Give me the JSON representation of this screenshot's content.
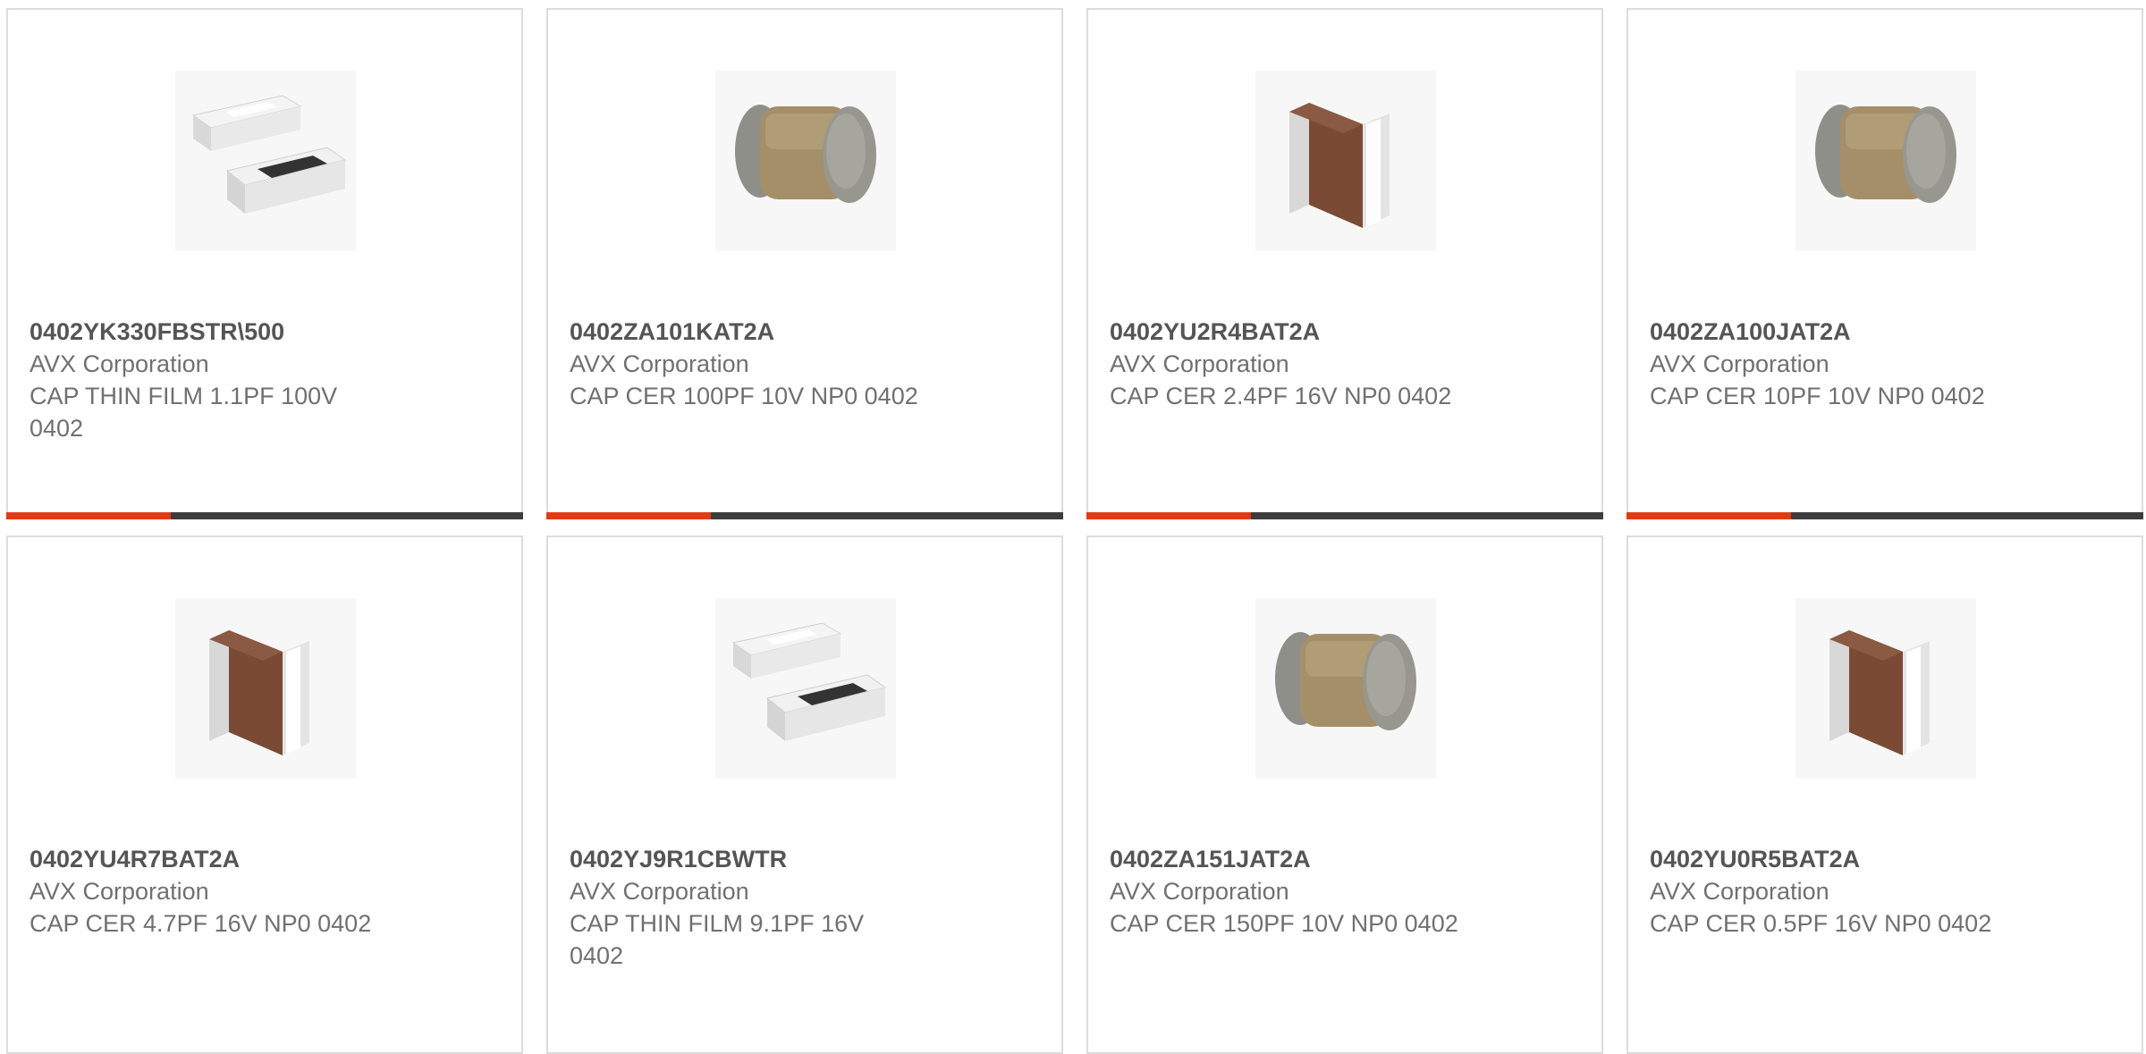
{
  "products": [
    {
      "part_number": "0402YK330FBSTR\\500",
      "manufacturer": "AVX Corporation",
      "description": "CAP THIN FILM 1.1PF 100V 0402",
      "image_icon": "thin-film-chip-icon"
    },
    {
      "part_number": "0402ZA101KAT2A",
      "manufacturer": "AVX Corporation",
      "description": "CAP CER 100PF 10V NP0 0402",
      "image_icon": "ceramic-chip-tan-icon"
    },
    {
      "part_number": "0402YU2R4BAT2A",
      "manufacturer": "AVX Corporation",
      "description": "CAP CER 2.4PF 16V NP0 0402",
      "image_icon": "ceramic-chip-brown-icon"
    },
    {
      "part_number": "0402ZA100JAT2A",
      "manufacturer": "AVX Corporation",
      "description": "CAP CER 10PF 10V NP0 0402",
      "image_icon": "ceramic-chip-tan-icon"
    },
    {
      "part_number": "0402YU4R7BAT2A",
      "manufacturer": "AVX Corporation",
      "description": "CAP CER 4.7PF 16V NP0 0402",
      "image_icon": "ceramic-chip-brown-icon"
    },
    {
      "part_number": "0402YJ9R1CBWTR",
      "manufacturer": "AVX Corporation",
      "description": "CAP THIN FILM 9.1PF 16V 0402",
      "image_icon": "thin-film-chip-icon"
    },
    {
      "part_number": "0402ZA151JAT2A",
      "manufacturer": "AVX Corporation",
      "description": "CAP CER 150PF 10V NP0 0402",
      "image_icon": "ceramic-chip-tan-icon"
    },
    {
      "part_number": "0402YU0R5BAT2A",
      "manufacturer": "AVX Corporation",
      "description": "CAP CER 0.5PF 16V NP0 0402",
      "image_icon": "ceramic-chip-brown-icon"
    }
  ],
  "colors": {
    "accent": "#e23a12",
    "bar": "#3d3d3d",
    "border": "#dcdcdc",
    "part_number_text": "#555555",
    "secondary_text": "#707070"
  }
}
